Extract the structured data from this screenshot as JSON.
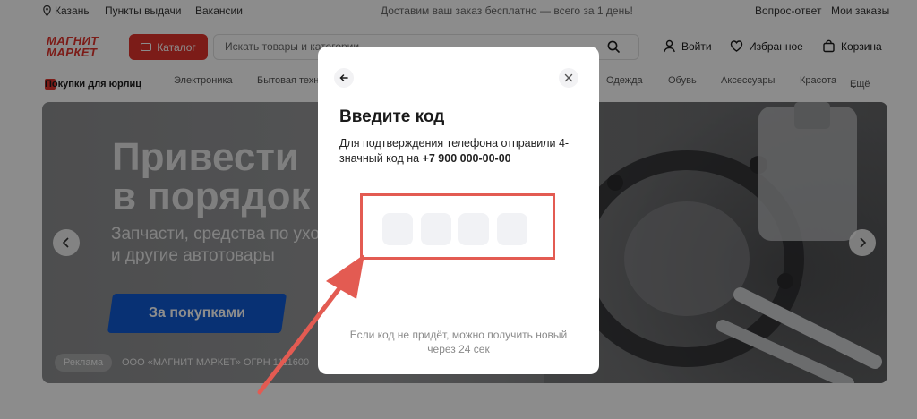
{
  "topbar": {
    "city": "Казань",
    "pickup": "Пункты выдачи",
    "jobs": "Вакансии",
    "promo": "Доставим ваш заказ бесплатно — всего за 1 день!",
    "faq": "Вопрос-ответ",
    "orders": "Мои заказы"
  },
  "header": {
    "logo_line1": "МАГНИТ",
    "logo_line2": "МАРКЕТ",
    "catalog": "Каталог",
    "search_placeholder": "Искать товары и категории",
    "login": "Войти",
    "favorites": "Избранное",
    "cart": "Корзина"
  },
  "nav": {
    "business": "Покупки для юрлиц",
    "items": [
      "Электроника",
      "Бытовая техника",
      "Одежда",
      "Обувь",
      "Аксессуары",
      "Красота"
    ],
    "more": "Ещё"
  },
  "banner": {
    "title": "Привести\nв порядок",
    "subtitle": "Запчасти, средства по уходу\nи другие автотовары",
    "cta": "За покупками",
    "ad_label": "Реклама",
    "ad_company": "ООО «МАГНИТ МАРКЕТ» ОГРН 1111600"
  },
  "modal": {
    "title": "Введите код",
    "desc_prefix": "Для подтверждения телефона отправили 4-значный код на ",
    "phone": "+7 900 000-00-00",
    "resend": "Если код не придёт, можно получить новый через 24 сек"
  },
  "colors": {
    "brand": "#e2342d",
    "cta_blue": "#0f5ad3",
    "highlight": "#e35b52"
  }
}
